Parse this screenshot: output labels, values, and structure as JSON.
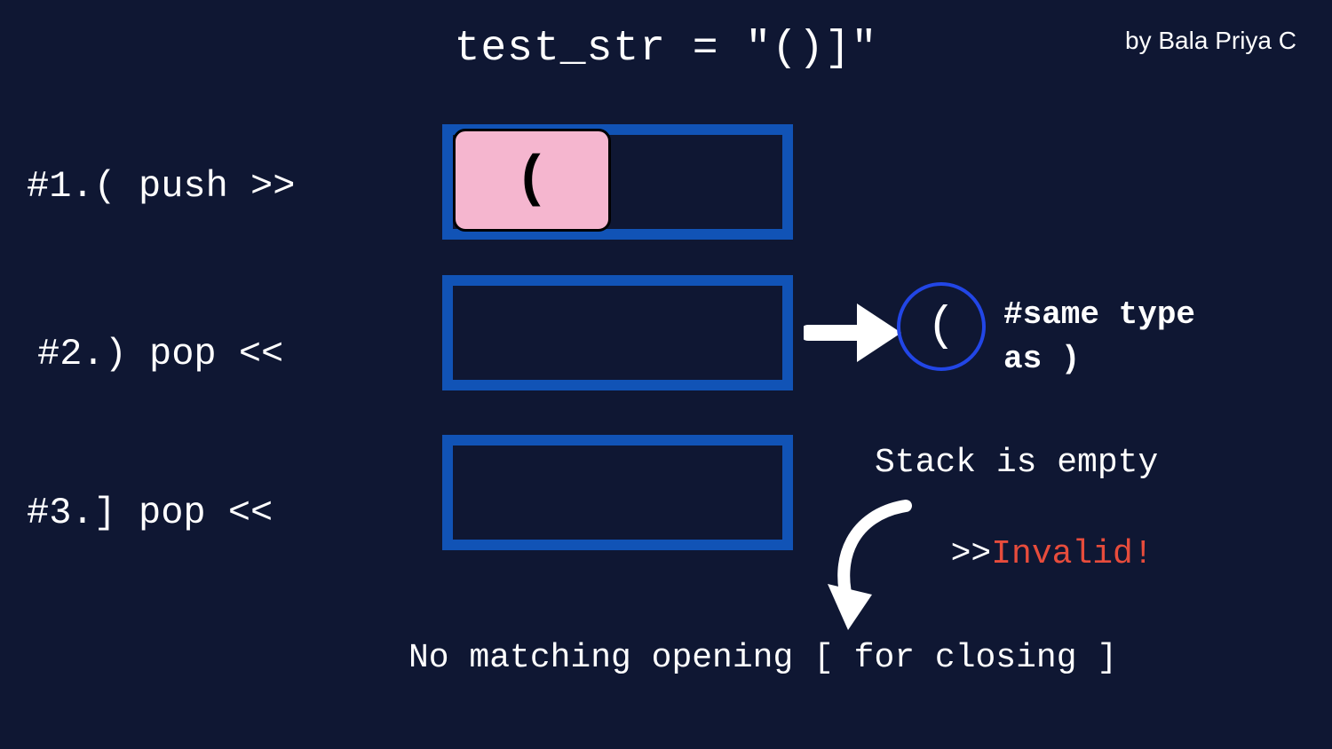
{
  "title": "test_str = \"()]\"",
  "attribution": "by Bala Priya C",
  "step1": {
    "label": "#1.( push >>",
    "slot_char": "("
  },
  "step2": {
    "label": "#2.) pop <<",
    "popped_char": "(",
    "note": "#same type\nas )"
  },
  "step3": {
    "label": "#3.] pop <<",
    "status_top": "Stack is empty",
    "status_prefix": ">>",
    "status_invalid": "Invalid!"
  },
  "bottom_message": "No matching opening [ for closing ]"
}
